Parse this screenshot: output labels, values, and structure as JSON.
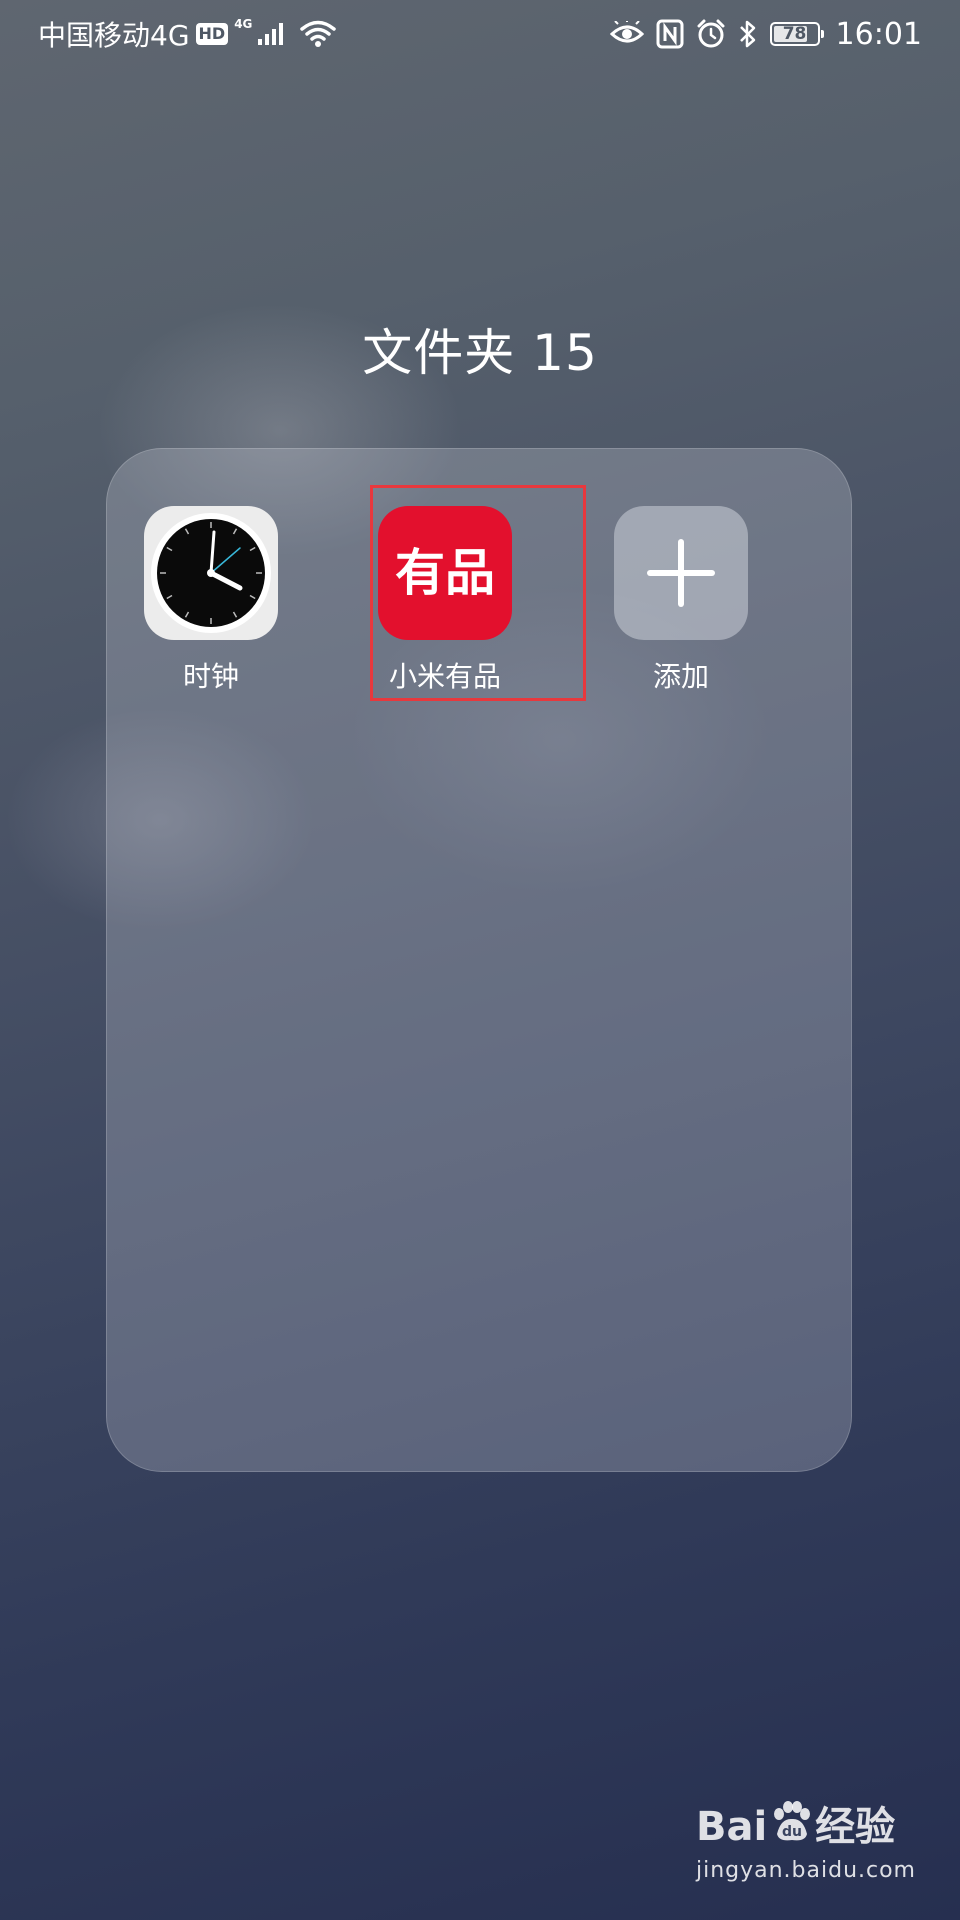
{
  "status_bar": {
    "carrier": "中国移动4G",
    "hd_badge": "HD",
    "network_type": "4G",
    "battery": "78",
    "battery_level_percent": 78,
    "time": "16:01",
    "icons": [
      "signal-icon",
      "wifi-icon",
      "eye-icon",
      "nfc-icon",
      "alarm-icon",
      "bluetooth-icon",
      "battery-icon"
    ]
  },
  "folder": {
    "title": "文件夹 15",
    "apps": [
      {
        "label": "时钟",
        "icon": "clock-icon"
      },
      {
        "label": "小米有品",
        "icon": "youpin-icon",
        "icon_text": "有品",
        "highlighted": true
      },
      {
        "label": "添加",
        "icon": "plus-icon"
      }
    ]
  },
  "watermark": {
    "main_left": "Bai",
    "main_right": "经验",
    "sub": "jingyan.baidu.com"
  },
  "colors": {
    "youpin_red": "#e3102d",
    "highlight_border": "#e8383d"
  }
}
